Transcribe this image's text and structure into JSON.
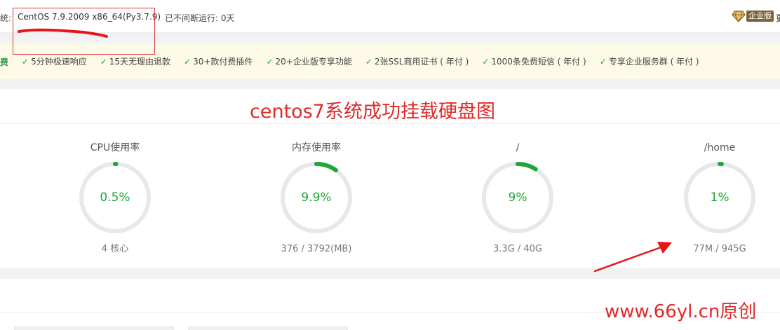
{
  "header": {
    "system_prefix": "统:",
    "system_name": "CentOS 7.9.2009 x86_64(Py3.7.9)",
    "uptime": "已不间断运行: 0天",
    "enterprise_label": "企业版",
    "edge_text": "更"
  },
  "features": {
    "head": "费",
    "items": [
      "5分钟极速响应",
      "15天无理由退款",
      "30+款付费插件",
      "20+企业版专享功能",
      "2张SSL商用证书 ( 年付 )",
      "1000条免费短信 ( 年付 )",
      "专享企业服务群 ( 年付 )"
    ]
  },
  "annotation": {
    "title": "centos7系统成功挂载硬盘图",
    "watermark": "www.66yl.cn原创"
  },
  "gauges": [
    {
      "label": "CPU使用率",
      "value": "0.5%",
      "percent": 0.5,
      "detail": "4 核心"
    },
    {
      "label": "内存使用率",
      "value": "9.9%",
      "percent": 9.9,
      "detail": "376 / 3792(MB)"
    },
    {
      "label": "/",
      "value": "9%",
      "percent": 9,
      "detail": "3.3G / 40G"
    },
    {
      "label": "/home",
      "value": "1%",
      "percent": 1,
      "detail": "77M / 945G"
    }
  ],
  "colors": {
    "accent_green": "#20a53a",
    "annotation_red": "#e02a2a",
    "ring_track": "#e8e8e8",
    "enterprise_gold": "#7c6236"
  }
}
